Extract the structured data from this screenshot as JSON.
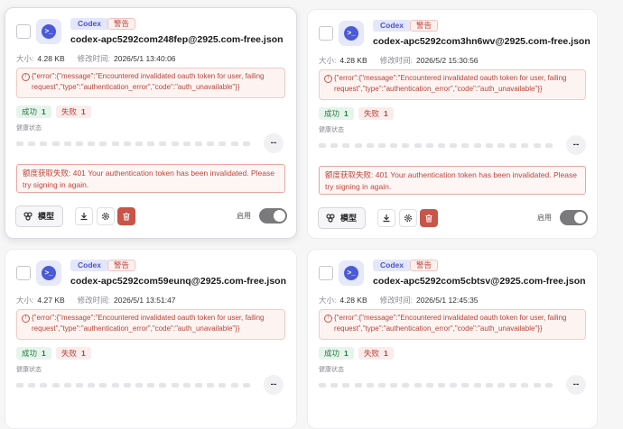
{
  "labels": {
    "codex_badge": "Codex",
    "warn_badge": "警告",
    "size_label": "大小:",
    "modified_label": "修改时间:",
    "success_label": "成功",
    "fail_label": "失败",
    "health_label": "健康状态",
    "health_value": "--",
    "model_button": "模型",
    "enable_label": "启用"
  },
  "cards": [
    {
      "filename": "codex-apc5292com248fep@2925.com-free.json",
      "size": "4.28 KB",
      "modified": "2026/5/1 13:40:06",
      "error": "{\"error\":{\"message\":\"Encountered invalidated oauth token for user, failing request\",\"type\":\"authentication_error\",\"code\":\"auth_unavailable\"}}",
      "success": "1",
      "fail": "1",
      "quota_error": "额度获取失败: 401 Your authentication token has been invalidated. Please try signing in again.",
      "enabled": true
    },
    {
      "filename": "codex-apc5292com3hn6wv@2925.com-free.json",
      "size": "4.28 KB",
      "modified": "2026/5/2 15:30:56",
      "error": "{\"error\":{\"message\":\"Encountered invalidated oauth token for user, failing request\",\"type\":\"authentication_error\",\"code\":\"auth_unavailable\"}}",
      "success": "1",
      "fail": "1",
      "quota_error": "额度获取失败: 401 Your authentication token has been invalidated. Please try signing in again.",
      "enabled": true
    },
    {
      "filename": "codex-apc5292com59eunq@2925.com-free.json",
      "size": "4.27 KB",
      "modified": "2026/5/1 13:51:47",
      "error": "{\"error\":{\"message\":\"Encountered invalidated oauth token for user, failing request\",\"type\":\"authentication_error\",\"code\":\"auth_unavailable\"}}",
      "success": "1",
      "fail": "1"
    },
    {
      "filename": "codex-apc5292com5cbtsv@2925.com-free.json",
      "size": "4.28 KB",
      "modified": "2026/5/1 12:45:35",
      "error": "{\"error\":{\"message\":\"Encountered invalidated oauth token for user, failing request\",\"type\":\"authentication_error\",\"code\":\"auth_unavailable\"}}",
      "success": "1",
      "fail": "1"
    }
  ]
}
